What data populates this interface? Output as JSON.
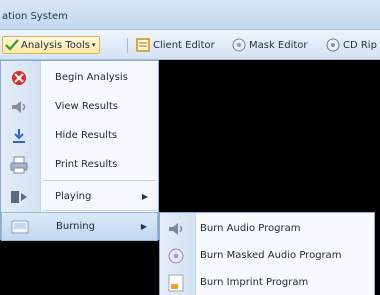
{
  "window": {
    "title": "ation System"
  },
  "toolbar": {
    "analysis_tools": "Analysis Tools",
    "client_editor": "Client Editor",
    "mask_editor": "Mask Editor",
    "cd_rip": "CD Rip"
  },
  "menu": {
    "items": [
      {
        "label": "Begin Analysis",
        "icon": "begin-analysis-icon"
      },
      {
        "label": "View Results",
        "icon": "view-results-icon"
      },
      {
        "label": "Hide Results",
        "icon": "hide-results-icon"
      },
      {
        "label": "Print Results",
        "icon": "printer-icon"
      },
      {
        "label": "Playing",
        "icon": "playing-icon",
        "submenu": true
      },
      {
        "label": "Burning",
        "icon": "burning-icon",
        "submenu": true,
        "highlighted": true
      }
    ]
  },
  "submenu": {
    "items": [
      {
        "label": "Burn Audio Program",
        "icon": "speaker-icon"
      },
      {
        "label": "Burn Masked Audio Program",
        "icon": "disc-icon"
      },
      {
        "label": "Burn Imprint Program",
        "icon": "imprint-icon"
      }
    ]
  },
  "colors": {
    "menu_highlight": "#c2d7f1",
    "toolbar_active": "#ffe7a3",
    "workspace": "#000000"
  }
}
